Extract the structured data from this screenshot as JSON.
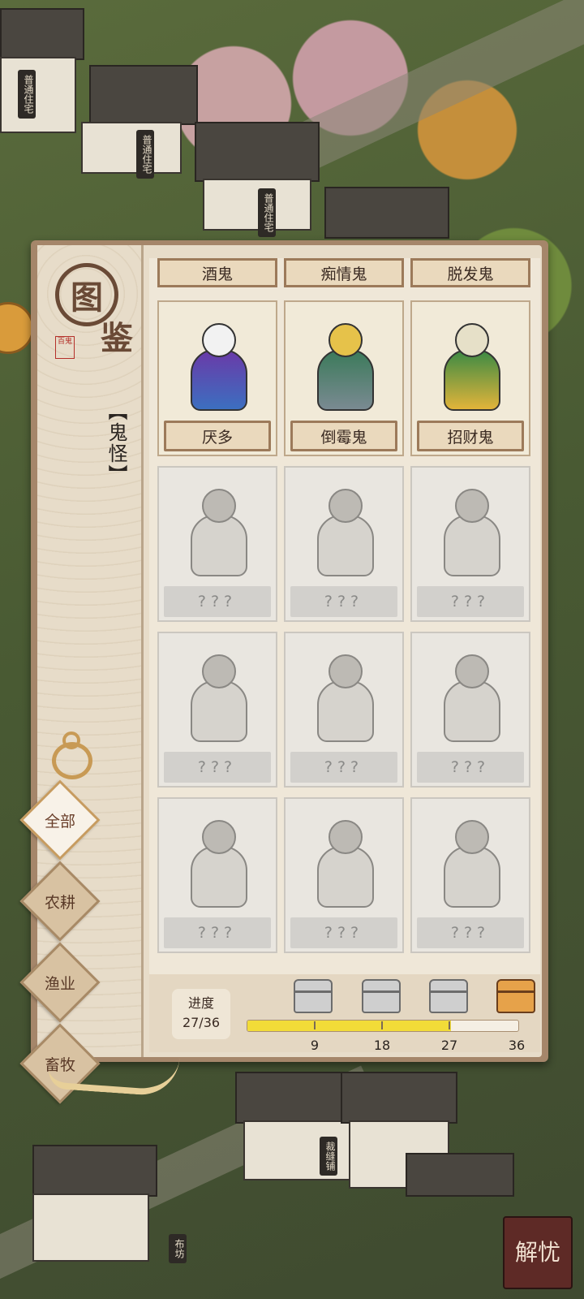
{
  "background": {
    "signs": [
      "普通住宅",
      "普通住宅",
      "普通住宅",
      "裁缝铺",
      "布坊"
    ],
    "corner_button": "解忧"
  },
  "panel": {
    "logo_main": "图",
    "logo_second": "鉴",
    "logo_seal": "百鬼",
    "category": "【鬼怪】",
    "tabs": [
      {
        "label": "全部",
        "active": true
      },
      {
        "label": "农耕",
        "active": false
      },
      {
        "label": "渔业",
        "active": false
      },
      {
        "label": "畜牧",
        "active": false
      }
    ],
    "top_row": [
      "酒鬼",
      "痴情鬼",
      "脱发鬼"
    ],
    "cards": [
      {
        "name": "厌多",
        "known": true,
        "colors": [
          "#f2f2f2",
          "#6a3aa8",
          "#3c6fc0"
        ]
      },
      {
        "name": "倒霉鬼",
        "known": true,
        "colors": [
          "#e6c24a",
          "#3b7a5a",
          "#7a8a92"
        ]
      },
      {
        "name": "招财鬼",
        "known": true,
        "colors": [
          "#e6e0c8",
          "#3c8a44",
          "#e2b43a"
        ]
      },
      {
        "name": "???",
        "known": false
      },
      {
        "name": "???",
        "known": false
      },
      {
        "name": "???",
        "known": false
      },
      {
        "name": "???",
        "known": false
      },
      {
        "name": "???",
        "known": false
      },
      {
        "name": "???",
        "known": false
      },
      {
        "name": "???",
        "known": false
      },
      {
        "name": "???",
        "known": false
      },
      {
        "name": "???",
        "known": false
      }
    ],
    "progress": {
      "label": "进度",
      "value_text": "27/36",
      "fraction": 0.75,
      "milestones": [
        "9",
        "18",
        "27",
        "36"
      ]
    }
  }
}
